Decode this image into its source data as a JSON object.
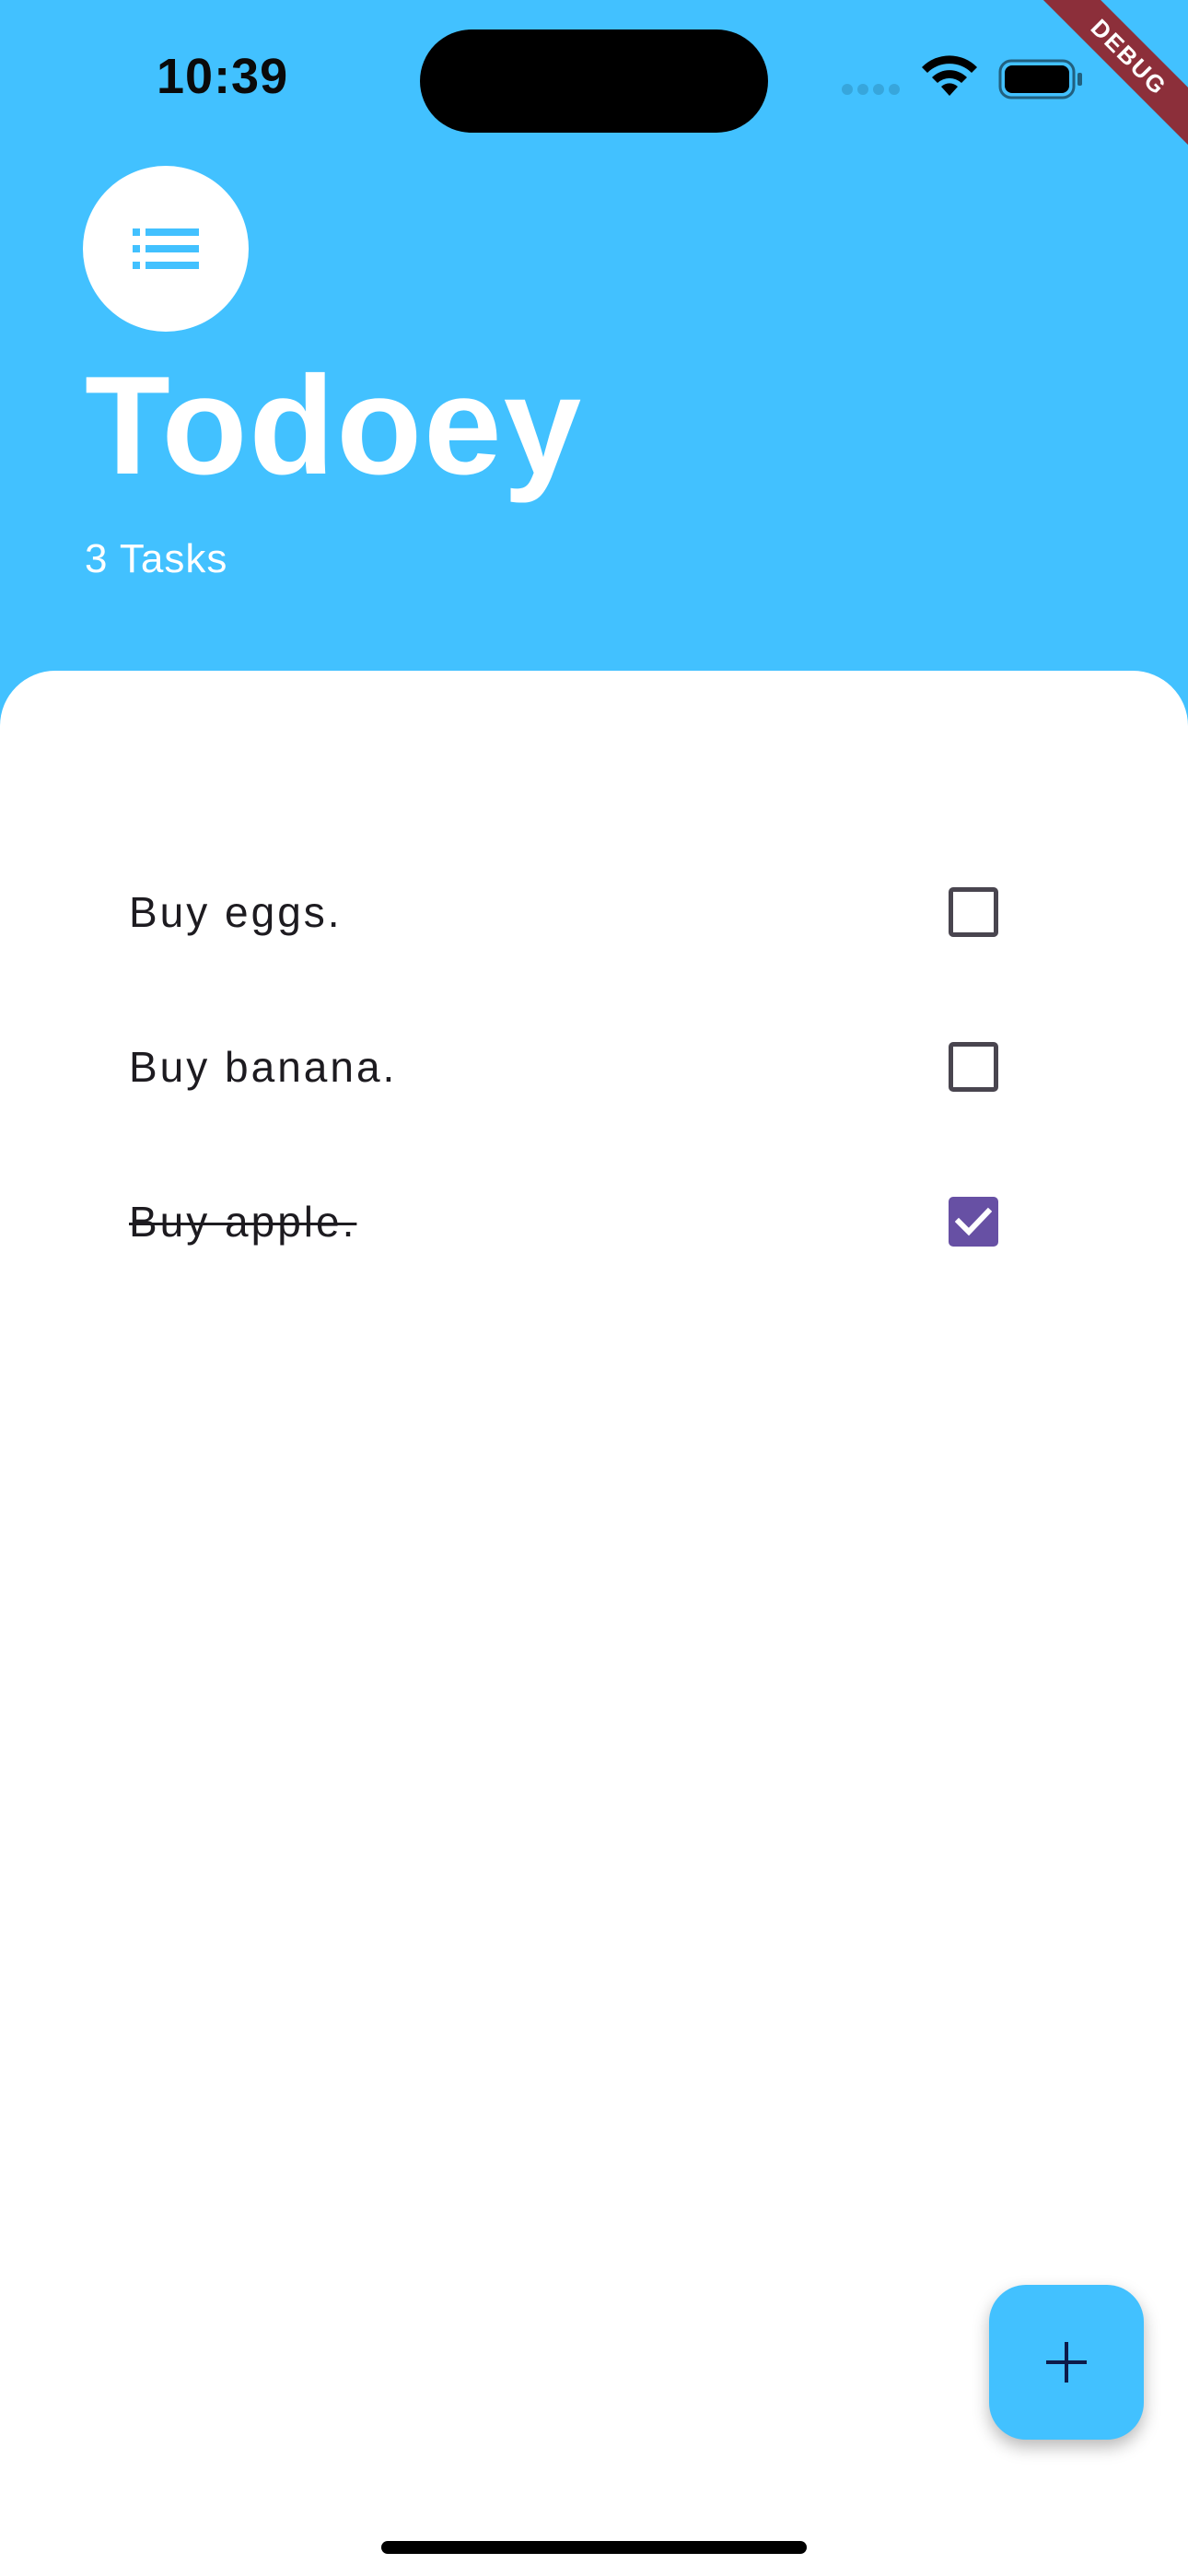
{
  "status_bar": {
    "time": "10:39",
    "icons": [
      "cellular-signal-icon",
      "wifi-icon",
      "battery-icon"
    ]
  },
  "debug_banner": {
    "label": "DEBUG",
    "color": "#8c2f3a"
  },
  "header": {
    "icon": "list-icon",
    "title": "Todoey",
    "task_count": "3 Tasks",
    "background_color": "#42C1FF"
  },
  "tasks": [
    {
      "label": "Buy eggs.",
      "done": false
    },
    {
      "label": "Buy banana.",
      "done": false
    },
    {
      "label": "Buy apple.",
      "done": true
    }
  ],
  "fab": {
    "icon": "plus-icon",
    "color": "#42C1FF"
  },
  "colors": {
    "accent": "#42C1FF",
    "checkbox_checked": "#6750A4"
  }
}
